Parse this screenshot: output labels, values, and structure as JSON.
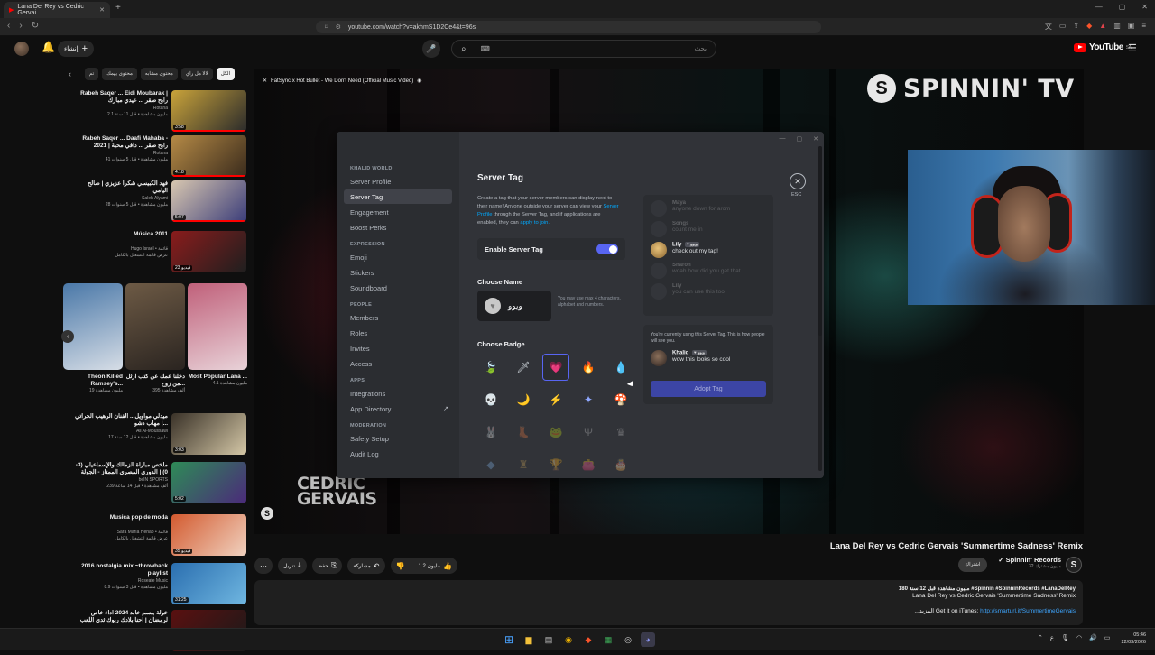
{
  "browser": {
    "tab_title": "Lana Del Rey vs Cedric Gervai",
    "url": "youtube.com/watch?v=akhmS1D2Ce4&t=96s"
  },
  "youtube_header": {
    "create_label": "إنشاء",
    "search_placeholder": "بحث",
    "logo_text": "YouTube",
    "logo_region": "SA"
  },
  "chips": [
    "الكل",
    "لالا مل راي",
    "محتوى مشابه",
    "محتوى يهمك",
    "تم"
  ],
  "recommendations": [
    {
      "title": "Rabeh Saqer ... Eidi Moubarak | رابح صقر ... عيدي مبارك",
      "channel": "Rotana",
      "meta": "2.1 مليون مشاهدة • قبل 11 سنة",
      "duration": "3:58",
      "colors": [
        "#c9a33a",
        "#2b2b2b"
      ]
    },
    {
      "title": "Rabeh Saqer ... Daafi Mahaba - 2021 | رابح صقر ... دافي محبة",
      "channel": "Rotana",
      "meta": "41 مليون مشاهدة • قبل 5 سنوات",
      "duration": "4:18",
      "colors": [
        "#b58a46",
        "#3a2b1c"
      ]
    },
    {
      "title": "فهد الكبيسي شكرا عزيزي | صالح اليامي",
      "channel": "Saleh Alyami",
      "meta": "28 مليون مشاهدة • قبل 5 سنوات",
      "duration": "5:07",
      "colors": [
        "#d8c7b0",
        "#3b3d7a"
      ]
    },
    {
      "title": "Música 2011",
      "channel": "Hugo Israel • قائمة",
      "meta": "عرض قائمة التشغيل بالكامل",
      "duration": "23 فيديو",
      "colors": [
        "#8a1c1c",
        "#1f1f1f"
      ]
    },
    {
      "title": "ميدلي مواويل... الفنان الرهيب الحراتي | مهاب دشو...",
      "channel": "Ali Al-Moussawi",
      "meta": "17 مليون مشاهدة • قبل 12 سنة",
      "duration": "3:03",
      "colors": [
        "#3a3228",
        "#d4c7a6"
      ]
    },
    {
      "title": "ملخص مباراة الزمالك والإسماعيلي (3-0) | الدوري المصري الممتاز - الجولة 31",
      "channel": "beIN SPORTS",
      "meta": "239 ألف مشاهدة • قبل 14 ساعة",
      "duration": "5:02",
      "colors": [
        "#2e8b57",
        "#4b2a7a"
      ]
    },
    {
      "title": "Musica pop de moda",
      "channel": "Sara María Henao • قائمة",
      "meta": "عرض قائمة التشغيل بالكامل",
      "duration": "35 فيديو",
      "colors": [
        "#d35a2f",
        "#f0d2c0"
      ]
    },
    {
      "title": "2016 nostalgia mix ~throwback playlist",
      "channel": "Roseate Music",
      "meta": "8.9 مليون مشاهدة • قبل 3 سنوات",
      "duration": "31:25",
      "colors": [
        "#2b6fb0",
        "#6fb6e0"
      ]
    },
    {
      "title": "خولة بلسم خالد 2024 اداء خاص لرمضان | احنا بلادك ربوك ثدي اللعب طريقه",
      "channel": "",
      "meta": "",
      "duration": "",
      "colors": [
        "#5a1010",
        "#1a1a1a"
      ]
    }
  ],
  "shorts": [
    {
      "title": "Most Popular Lana ...",
      "views": "4.1 مليون مشاهدة",
      "colors": [
        "#c0607a",
        "#e8d2d8"
      ]
    },
    {
      "title": "دخلنا عمك عن كتب ارثل من زوح...",
      "views": "395 ألف مشاهدة",
      "colors": [
        "#6d5a45",
        "#2a2420"
      ]
    },
    {
      "title": "Theon Killed Ramsey's...",
      "views": "19 مليون مشاهدة",
      "colors": [
        "#4a78a8",
        "#d6dde6"
      ]
    }
  ],
  "player": {
    "video_title_overlay": "FatSync x Hot Bullet - We Don't Need (Official Music Video)",
    "brand_logo": "SPINNIN' TV",
    "artist_logo_line1": "CEDRIC",
    "artist_logo_line2": "GERVAIS"
  },
  "discord": {
    "server_name": "KHALID WORLD",
    "sidebar": [
      {
        "type": "group",
        "label": "KHALID WORLD"
      },
      {
        "type": "item",
        "label": "Server Profile"
      },
      {
        "type": "item",
        "label": "Server Tag",
        "active": true
      },
      {
        "type": "item",
        "label": "Engagement"
      },
      {
        "type": "item",
        "label": "Boost Perks"
      },
      {
        "type": "group",
        "label": "EXPRESSION"
      },
      {
        "type": "item",
        "label": "Emoji"
      },
      {
        "type": "item",
        "label": "Stickers"
      },
      {
        "type": "item",
        "label": "Soundboard"
      },
      {
        "type": "group",
        "label": "PEOPLE"
      },
      {
        "type": "item",
        "label": "Members"
      },
      {
        "type": "item",
        "label": "Roles"
      },
      {
        "type": "item",
        "label": "Invites"
      },
      {
        "type": "item",
        "label": "Access"
      },
      {
        "type": "group",
        "label": "APPS"
      },
      {
        "type": "item",
        "label": "Integrations"
      },
      {
        "type": "item",
        "label": "App Directory",
        "external": true
      },
      {
        "type": "group",
        "label": "MODERATION"
      },
      {
        "type": "item",
        "label": "Safety Setup"
      },
      {
        "type": "item",
        "label": "Audit Log"
      }
    ],
    "title": "Server Tag",
    "description_1": "Create a tag that your server members can display next to their name! Anyone outside your server can view your ",
    "description_link1": "Server Profile",
    "description_2": " through the Server Tag, and if applications are enabled, they can ",
    "description_link2": "apply to join.",
    "close_label": "ESC",
    "enable_label": "Enable Server Tag",
    "enable_value": true,
    "choose_name_label": "Choose Name",
    "tag_name": "ويوو",
    "name_hint": "You may use max 4 characters, alphabet and numbers.",
    "choose_badge_label": "Choose Badge",
    "badges": [
      {
        "icon": "leaf-icon",
        "glyph": "🍃",
        "color": "#7fc94b",
        "dim": false
      },
      {
        "icon": "sword-icon",
        "glyph": "🗡",
        "color": "#cfd6dc",
        "dim": false
      },
      {
        "icon": "heart-icon",
        "glyph": "💗",
        "color": "#ff6fa8",
        "dim": false,
        "selected": true
      },
      {
        "icon": "fire-icon",
        "glyph": "🔥",
        "color": "#ff7a3c",
        "dim": false
      },
      {
        "icon": "water-icon",
        "glyph": "💧",
        "color": "#7ec8f0",
        "dim": false
      },
      {
        "icon": "skull-icon",
        "glyph": "💀",
        "color": "#d8d8d8",
        "dim": false
      },
      {
        "icon": "moon-icon",
        "glyph": "🌙",
        "color": "#a98bf0",
        "dim": false
      },
      {
        "icon": "bolt-icon",
        "glyph": "⚡",
        "color": "#ffd23c",
        "dim": false
      },
      {
        "icon": "star-icon",
        "glyph": "✦",
        "color": "#8fa8ff",
        "dim": false
      },
      {
        "icon": "mushroom-icon",
        "glyph": "🍄",
        "color": "#ff5a5a",
        "dim": false
      },
      {
        "icon": "bunny-icon",
        "glyph": "🐰",
        "color": "#aaaaaa",
        "dim": true
      },
      {
        "icon": "boot-icon",
        "glyph": "👢",
        "color": "#d9a441",
        "dim": true
      },
      {
        "icon": "frog-icon",
        "glyph": "🐸",
        "color": "#7ab06b",
        "dim": true
      },
      {
        "icon": "antler-icon",
        "glyph": "Ψ",
        "color": "#bbbbbb",
        "dim": true
      },
      {
        "icon": "crown-icon",
        "glyph": "♛",
        "color": "#bbbbbb",
        "dim": true
      },
      {
        "icon": "gem-icon",
        "glyph": "◆",
        "color": "#7fb0e0",
        "dim": true
      },
      {
        "icon": "castle-icon",
        "glyph": "♜",
        "color": "#c9a35a",
        "dim": true
      },
      {
        "icon": "trophy-icon",
        "glyph": "🏆",
        "color": "#d9b441",
        "dim": true
      },
      {
        "icon": "bag-icon",
        "glyph": "👛",
        "color": "#c9a35a",
        "dim": true
      },
      {
        "icon": "cake-icon",
        "glyph": "🎂",
        "color": "#7fc9b0",
        "dim": true
      }
    ],
    "preview_messages": [
      {
        "name": "Maya",
        "text": "anyone down for arcm",
        "faded": true
      },
      {
        "name": "Songs",
        "text": "count me in",
        "faded": true
      },
      {
        "name": "Lily",
        "tag": "ويوو",
        "text": "check out my tag!",
        "faded": false
      },
      {
        "name": "Sharon",
        "text": "woah how did you get that",
        "faded": true
      },
      {
        "name": "Lily",
        "text": "you can use this too",
        "faded": true
      }
    ],
    "adopt_note": "You're currently using this Server Tag. This is how people will see you.",
    "own_message": {
      "name": "Khalid",
      "tag": "ويوو",
      "text": "wow this looks so cool"
    },
    "adopt_button": "Adopt Tag"
  },
  "video": {
    "title": "Lana Del Rey vs Cedric Gervais 'Summertime Sadness' Remix",
    "channel": "Spinnin' Records",
    "subscribers": "32 مليون مشترك",
    "subscribe_label": "اشتراك",
    "likes": "1.2 مليون",
    "share_label": "مشاركة",
    "save_label": "حفظ",
    "download_label": "تنزيل",
    "desc_stats": "180 مليون مشاهدة قبل 12 سنة #Spinnin #SpinninRecords #LanaDelRey",
    "desc_title": "Lana Del Rey vs Cedric Gervais 'Summertime Sadness' Remix",
    "desc_link_prefix": "...المزيد         Get it on iTunes: ",
    "desc_link": "http://smarturl.it/SummertimeGervais"
  },
  "taskbar": {
    "time": "05:46",
    "date": "22/03/2026",
    "lang": "ع"
  }
}
